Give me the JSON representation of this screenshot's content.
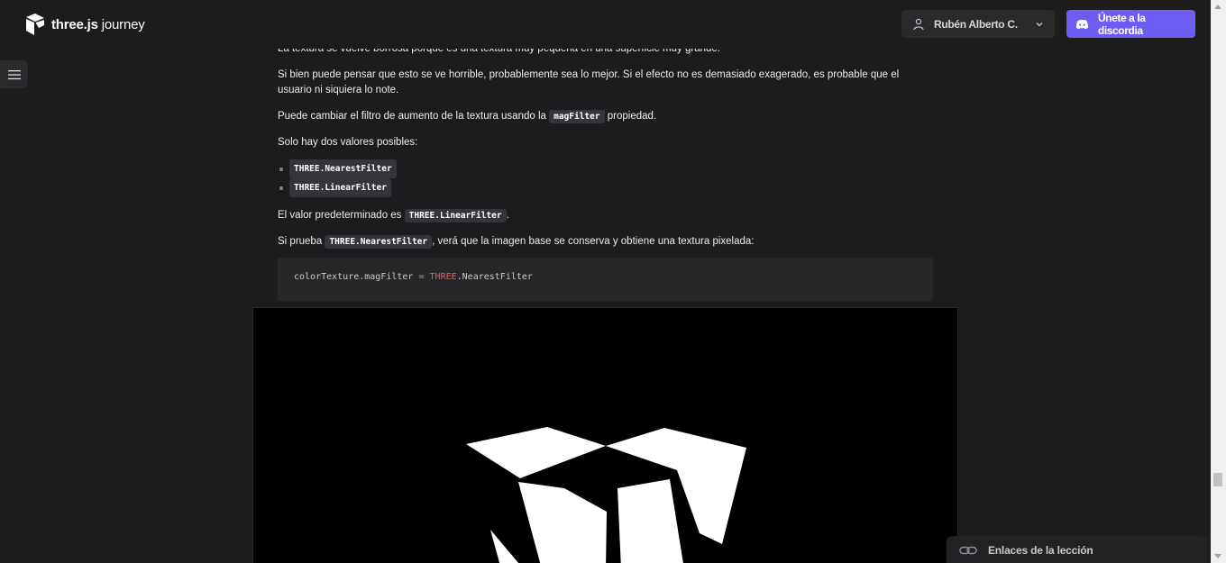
{
  "header": {
    "logo_bold": "three.js",
    "logo_light": " journey",
    "user_name": "Rubén Alberto C.",
    "discord_label": "Únete a la discordia"
  },
  "content": {
    "p1": "La textura se vuelve borrosa porque es una textura muy pequeña en una superficie muy grande.",
    "p2": "Si bien puede pensar que esto se ve horrible, probablemente sea lo mejor. Si el efecto no es demasiado exagerado, es probable que el usuario ni siquiera lo note.",
    "p3_before": "Puede cambiar el filtro de aumento de la textura usando la ",
    "p3_code": "magFilter",
    "p3_after": " propiedad.",
    "p4": "Solo hay dos valores posibles:",
    "values": [
      "THREE.NearestFilter",
      "THREE.LinearFilter"
    ],
    "p5_before": "El valor predeterminado es ",
    "p5_code": "THREE.LinearFilter",
    "p5_after": ".",
    "p6_before": "Si prueba ",
    "p6_code": "THREE.NearestFilter",
    "p6_after": ", verá que la imagen base se conserva y obtiene una textura pixelada:"
  },
  "code": {
    "obj": "colorTexture",
    "prop": ".magFilter",
    "op": " = ",
    "kw": "THREE",
    "val": ".NearestFilter"
  },
  "links_panel": {
    "label": "Enlaces de la lección"
  },
  "icons": {
    "logo": "threejs-logo-icon",
    "menu": "hamburger-menu-icon",
    "user": "user-icon",
    "chevron": "chevron-down-icon",
    "discord": "discord-icon",
    "link": "link-icon"
  }
}
